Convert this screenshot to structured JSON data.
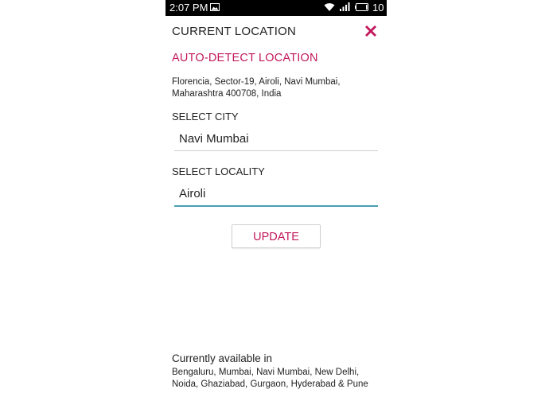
{
  "status_bar": {
    "time": "2:07 PM",
    "battery_level": "10",
    "icons": [
      "image-icon",
      "wifi-icon",
      "signal-icon",
      "battery-icon"
    ]
  },
  "dialog": {
    "title": "CURRENT LOCATION",
    "close_icon": "close-icon",
    "auto_detect_label": "AUTO-DETECT LOCATION",
    "detected_address": "Florencia, Sector-19, Airoli, Navi Mumbai, Maharashtra 400708, India",
    "city": {
      "label": "SELECT CITY",
      "value": "Navi Mumbai"
    },
    "locality": {
      "label": "SELECT LOCALITY",
      "value": "Airoli"
    },
    "update_label": "UPDATE"
  },
  "availability": {
    "title": "Currently available in",
    "cities": "Bengaluru, Mumbai, Navi Mumbai, New Delhi, Noida, Ghaziabad, Gurgaon, Hyderabad & Pune"
  },
  "colors": {
    "accent": "#c2185b",
    "focus_underline": "#4a9fb0",
    "status_bar": "#000000",
    "text": "#222222"
  }
}
